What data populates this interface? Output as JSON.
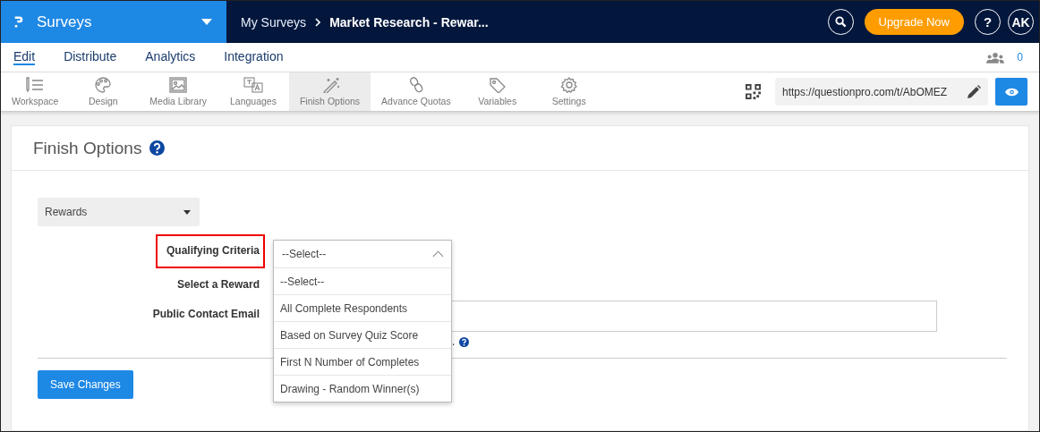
{
  "app": {
    "name": "Surveys"
  },
  "breadcrumb": [
    {
      "label": "My Surveys"
    },
    {
      "label": "Market Research - Rewar..."
    }
  ],
  "header_actions": {
    "upgrade": "Upgrade Now",
    "help": "?",
    "avatar": "AK"
  },
  "nav_tabs": [
    {
      "label": "Edit",
      "selected": true
    },
    {
      "label": "Distribute",
      "selected": false
    },
    {
      "label": "Analytics",
      "selected": false
    },
    {
      "label": "Integration",
      "selected": false
    }
  ],
  "collaborators": "0",
  "toolbar": [
    {
      "label": "Workspace",
      "kind": "list",
      "selected": false
    },
    {
      "label": "Design",
      "kind": "palette",
      "selected": false
    },
    {
      "label": "Media Library",
      "kind": "image",
      "selected": false
    },
    {
      "label": "Languages",
      "kind": "translate",
      "selected": false
    },
    {
      "label": "Finish Options",
      "kind": "wand",
      "selected": true
    },
    {
      "label": "Advance Quotas",
      "kind": "chain",
      "selected": false
    },
    {
      "label": "Variables",
      "kind": "tag",
      "selected": false
    },
    {
      "label": "Settings",
      "kind": "gear",
      "selected": false
    }
  ],
  "survey_url": "https://questionpro.com/t/AbOMEZ",
  "page": {
    "title": "Finish Options"
  },
  "section_select": {
    "value": "Rewards"
  },
  "form": [
    {
      "label": "Qualifying Criteria",
      "highlighted": true,
      "kind": "select"
    },
    {
      "label": "Select a Reward",
      "highlighted": false,
      "kind": "select"
    },
    {
      "label": "Public Contact Email",
      "highlighted": false,
      "kind": "input"
    }
  ],
  "dropdown": {
    "value": "--Select--",
    "expanded": true,
    "options": [
      {
        "label": "--Select--"
      },
      {
        "label": "All Complete Respondents"
      },
      {
        "label": "Based on Survey Quiz Score"
      },
      {
        "label": "First N Number of Completes"
      },
      {
        "label": "Drawing - Random Winner(s)"
      }
    ]
  },
  "email_hint": ".",
  "save_button": "Save Changes"
}
